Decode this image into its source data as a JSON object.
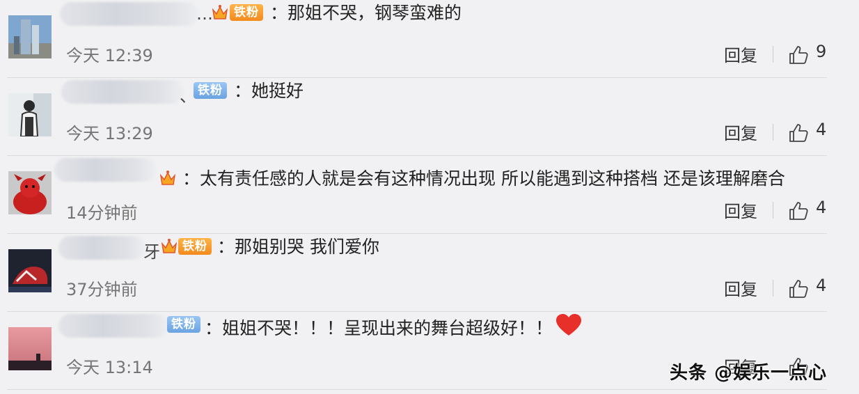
{
  "comments": [
    {
      "author_visible": "…",
      "fan_badge": "铁粉",
      "text": "：那姐不哭，钢琴蛮难的",
      "time": "今天 12:39",
      "reply_label": "回复",
      "likes": "9"
    },
    {
      "author_visible": "、",
      "fan_badge": "铁粉",
      "text": "：她挺好",
      "time": "今天 13:29",
      "reply_label": "回复",
      "likes": "4"
    },
    {
      "author_visible": "",
      "fan_badge": "",
      "text": "：太有责任感的人就是会有这种情况出现 所以能遇到这种搭档 还是该理解磨合",
      "time": "14分钟前",
      "reply_label": "回复",
      "likes": "4"
    },
    {
      "author_visible": "牙",
      "fan_badge": "铁粉",
      "text": "：那姐别哭 我们爱你",
      "time": "37分钟前",
      "reply_label": "回复",
      "likes": "4"
    },
    {
      "author_visible": "",
      "fan_badge": "铁粉",
      "text": "：姐姐不哭！！！呈现出来的舞台超级好！！",
      "time": "今天 13:14",
      "reply_label": "回复",
      "likes": ""
    }
  ],
  "watermark": "头条 @娱乐一点心",
  "colors": {
    "background": "#f1f1f3",
    "badge_orange": "#f38a1e",
    "badge_blue": "#6aa3e2",
    "heart": "#e8302b"
  }
}
